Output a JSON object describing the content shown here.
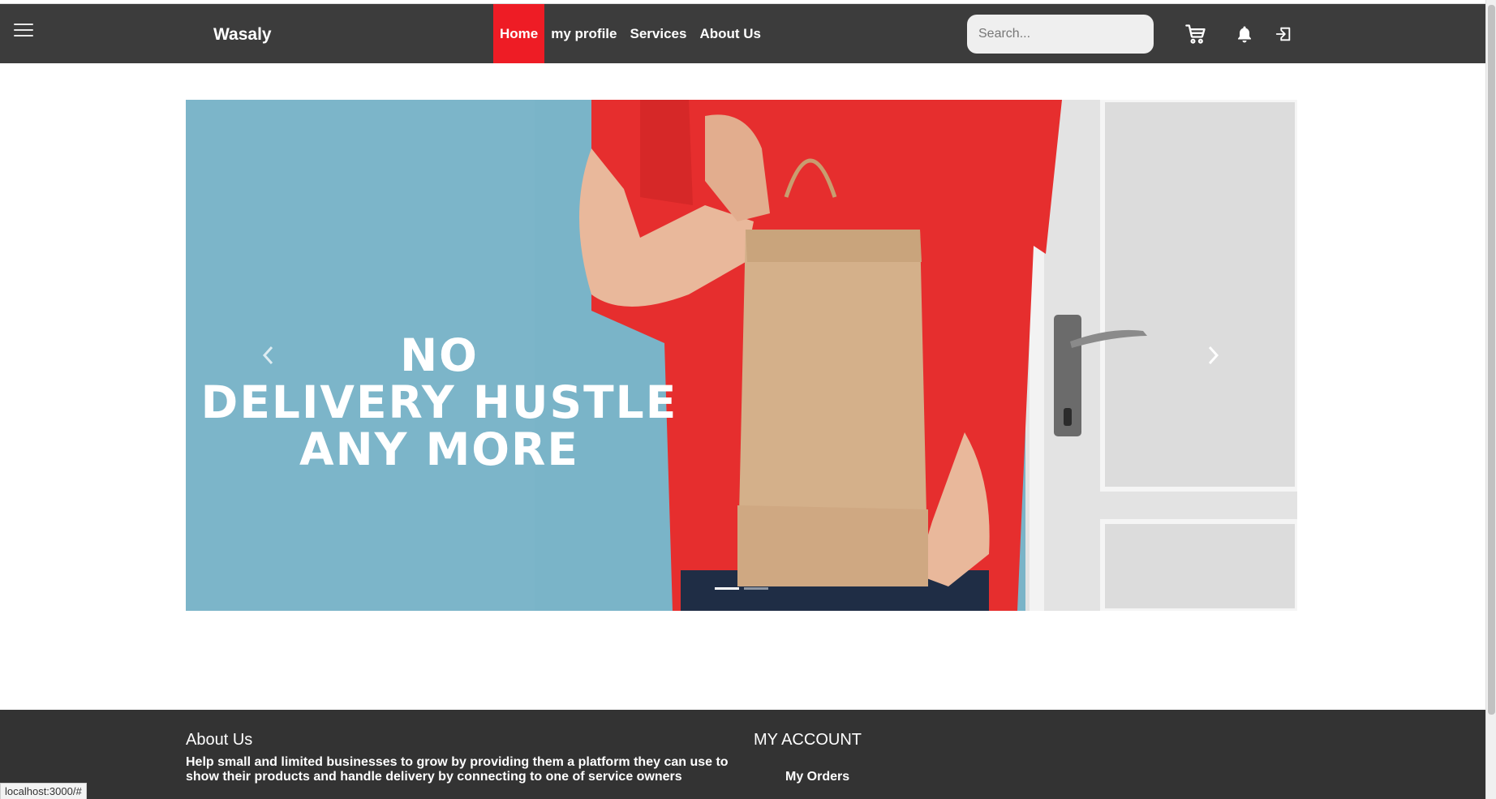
{
  "navbar": {
    "brand": "Wasaly",
    "links": [
      {
        "label": "Home",
        "active": true
      },
      {
        "label": "my profile",
        "active": false
      },
      {
        "label": "Services",
        "active": false
      },
      {
        "label": "About Us",
        "active": false
      }
    ],
    "search_placeholder": "Search...",
    "icons": [
      "menu-icon",
      "cart-icon",
      "bell-icon",
      "logout-icon"
    ]
  },
  "hero": {
    "caption_lines": [
      "NO",
      "DELIVERY HUSTLE",
      "ANY MORE"
    ],
    "slide_count": 2,
    "active_slide": 1,
    "background_color": "#7ab4c8"
  },
  "footer": {
    "about_title": "About Us",
    "about_text": "Help small and limited businesses to grow by providing them a platform they can use to show their products and handle delivery by connecting to one of service owners",
    "account_title": "MY ACCOUNT",
    "account_links": [
      "My Orders"
    ]
  },
  "status_bar": {
    "url": "localhost:3000/#"
  },
  "colors": {
    "navbar": "#3c3c3c",
    "accent": "#ee1c25",
    "footer": "#333333"
  }
}
